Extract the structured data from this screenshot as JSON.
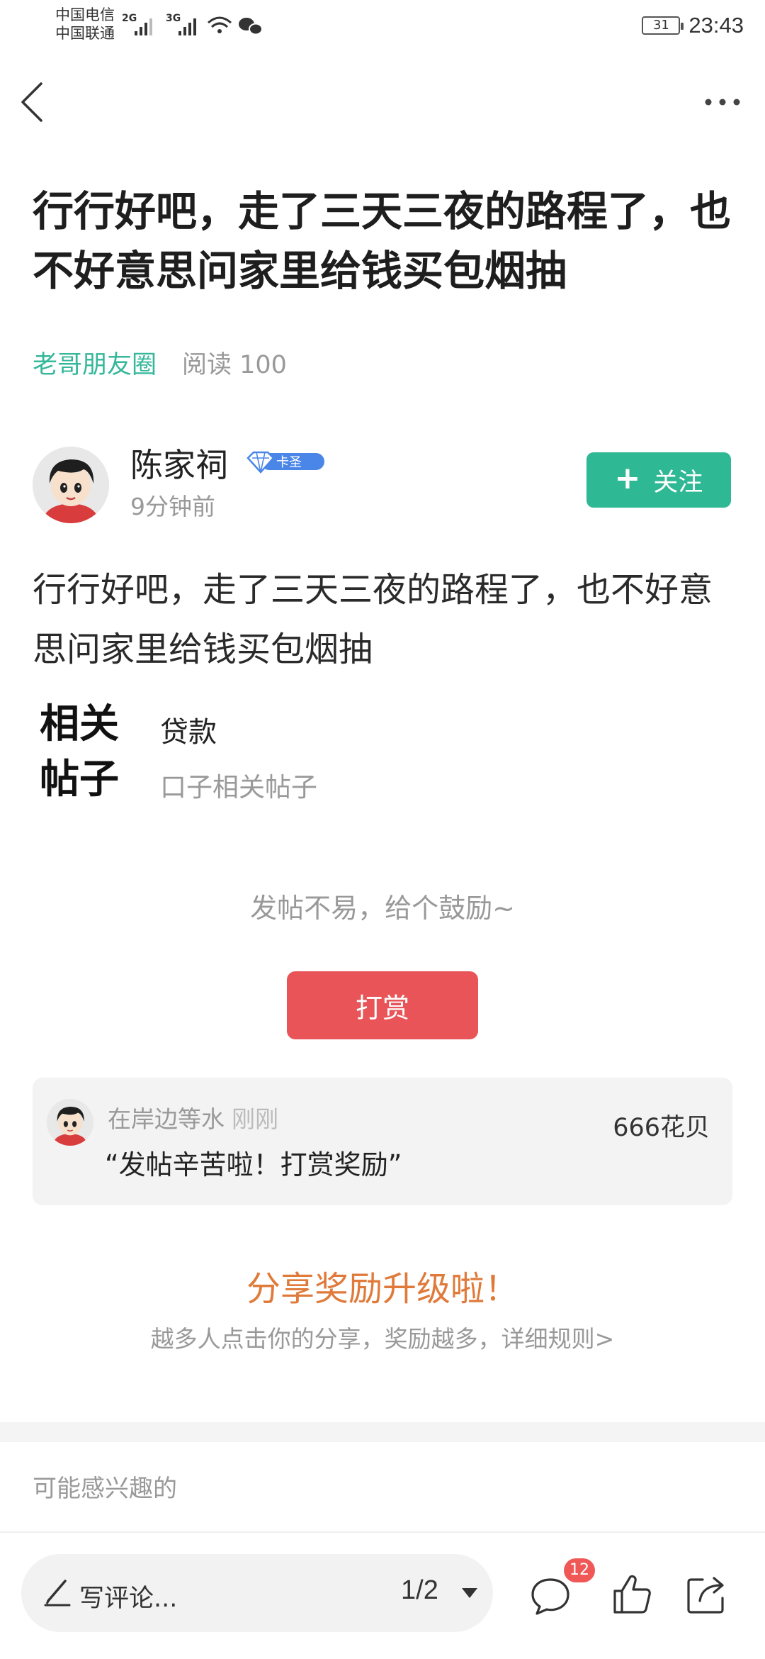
{
  "status_bar": {
    "carrier_1": "中国电信",
    "carrier_2": "中国联通",
    "network_1": "2G",
    "network_2": "3G",
    "battery": "31",
    "time": "23:43"
  },
  "post": {
    "title": "行行好吧，走了三天三夜的路程了，也不好意思问家里给钱买包烟抽",
    "circle": "老哥朋友圈",
    "reads": "阅读 100",
    "body": "行行好吧，走了三天三夜的路程了，也不好意思问家里给钱买包烟抽"
  },
  "author": {
    "name": "陈家祠",
    "badge": "卡圣",
    "time": "9分钟前",
    "follow_label": "关注"
  },
  "related": {
    "label": "相关帖子",
    "item_1": "贷款",
    "item_2": "口子相关帖子"
  },
  "tip": {
    "encourage_text": "发帖不易，给个鼓励~",
    "button_label": "打赏",
    "record": {
      "user": "在岸边等水",
      "time": "刚刚",
      "message": "“发帖辛苦啦！打赏奖励”",
      "amount": "666花贝"
    }
  },
  "share": {
    "title": "分享奖励升级啦！",
    "subtitle": "越多人点击你的分享，奖励越多，详细规则>"
  },
  "interest": {
    "label": "可能感兴趣的"
  },
  "bottom_bar": {
    "comment_placeholder": "写评论...",
    "page_indicator": "1/2",
    "comment_count": "12"
  },
  "colors": {
    "accent_green": "#2fb894",
    "tip_red": "#e85457",
    "share_orange": "#e07a3a"
  },
  "icons": [
    "back-arrow-icon",
    "more-icon",
    "diamond-badge-icon",
    "plus-icon",
    "pen-icon",
    "caret-down-icon",
    "comment-icon",
    "like-icon",
    "share-icon"
  ]
}
